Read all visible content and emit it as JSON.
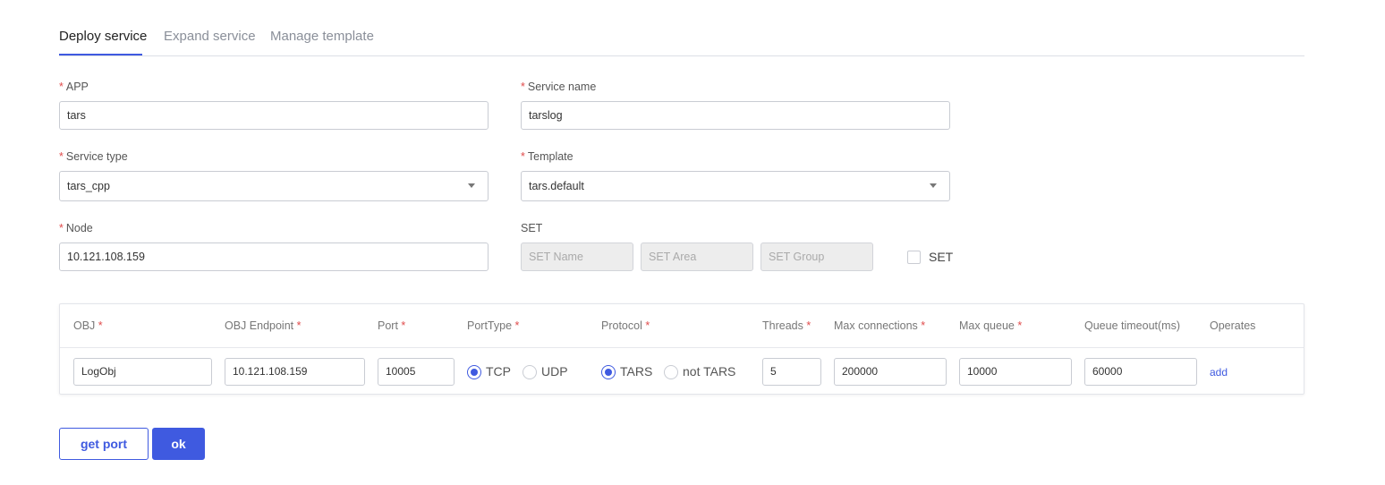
{
  "tabs": [
    {
      "label": "Deploy service",
      "active": true
    },
    {
      "label": "Expand service",
      "active": false
    },
    {
      "label": "Manage template",
      "active": false
    }
  ],
  "form": {
    "app": {
      "label": "APP",
      "required": "*",
      "value": "tars"
    },
    "service_name": {
      "label": "Service name",
      "required": "*",
      "value": "tarslog"
    },
    "service_type": {
      "label": "Service type",
      "required": "*",
      "value": "tars_cpp"
    },
    "template": {
      "label": "Template",
      "required": "*",
      "value": "tars.default"
    },
    "node": {
      "label": "Node",
      "required": "*",
      "value": "10.121.108.159"
    },
    "set": {
      "label": "SET",
      "name_placeholder": "SET Name",
      "area_placeholder": "SET Area",
      "group_placeholder": "SET Group",
      "checkbox_label": "SET",
      "checked": false
    }
  },
  "table": {
    "headers": [
      {
        "label": "OBJ",
        "required": "*"
      },
      {
        "label": "OBJ Endpoint",
        "required": "*"
      },
      {
        "label": "Port",
        "required": "*"
      },
      {
        "label": "PortType",
        "required": "*"
      },
      {
        "label": "Protocol",
        "required": "*"
      },
      {
        "label": "Threads",
        "required": "*"
      },
      {
        "label": "Max connections",
        "required": "*"
      },
      {
        "label": "Max queue",
        "required": "*"
      },
      {
        "label": "Queue timeout(ms)",
        "required": ""
      },
      {
        "label": "Operates",
        "required": ""
      }
    ],
    "row": {
      "obj": "LogObj",
      "endpoint": "10.121.108.159",
      "port": "10005",
      "port_type_options": [
        "TCP",
        "UDP"
      ],
      "port_type_selected": "TCP",
      "protocol_options": [
        "TARS",
        "not TARS"
      ],
      "protocol_selected": "TARS",
      "threads": "5",
      "max_connections": "200000",
      "max_queue": "10000",
      "queue_timeout": "60000",
      "operate": "add"
    }
  },
  "buttons": {
    "get_port": "get port",
    "ok": "ok"
  },
  "colors": {
    "accent": "#3f5ae0",
    "required": "#e04b4b",
    "border": "#c9ccd3"
  }
}
